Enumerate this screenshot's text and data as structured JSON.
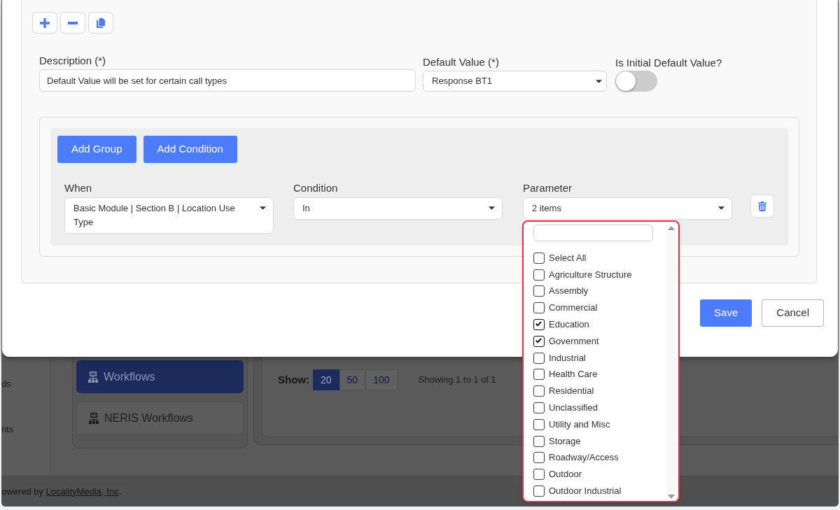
{
  "form": {
    "description": {
      "label": "Description (*)",
      "value": "Default Value will be set for certain call types"
    },
    "default_value": {
      "label": "Default Value (*)",
      "value": "Response BT1"
    },
    "is_initial_default": {
      "label": "Is Initial Default Value?",
      "on": false
    }
  },
  "query_builder": {
    "buttons": [
      "Add Group",
      "Add Condition"
    ],
    "rule": {
      "fields": [
        {
          "label": "When",
          "value": "Basic Module | Section B | Location Use Type"
        },
        {
          "label": "Condition",
          "value": "In"
        },
        {
          "label": "Parameter",
          "value": "2 items",
          "expanded": true,
          "dropdown": {
            "items": [
              {
                "label": "Select All",
                "checked": false
              },
              {
                "label": "Agriculture Structure",
                "checked": false
              },
              {
                "label": "Assembly",
                "checked": false
              },
              {
                "label": "Commercial",
                "checked": false
              },
              {
                "label": "Education",
                "checked": true
              },
              {
                "label": "Government",
                "checked": true
              },
              {
                "label": "Industrial",
                "checked": false
              },
              {
                "label": "Health Care",
                "checked": false
              },
              {
                "label": "Residential",
                "checked": false
              },
              {
                "label": "Unclassified",
                "checked": false
              },
              {
                "label": "Utility and Misc",
                "checked": false
              },
              {
                "label": "Storage",
                "checked": false
              },
              {
                "label": "Roadway/Access",
                "checked": false
              },
              {
                "label": "Outdoor",
                "checked": false
              },
              {
                "label": "Outdoor Industrial",
                "checked": false
              }
            ]
          }
        }
      ]
    }
  },
  "actions": [
    {
      "label": "Save",
      "kind": "primary"
    },
    {
      "label": "Cancel",
      "kind": "secondary"
    }
  ],
  "background_page": {
    "sidebar_items": [
      "ds",
      "nts"
    ],
    "menu_items": [
      {
        "label": "Workflows",
        "selected": true
      },
      {
        "label": "NERIS Workflows",
        "selected": false
      }
    ],
    "pagination": {
      "label": "Show:",
      "page_sizes": [
        {
          "label": "20",
          "selected": true
        },
        {
          "label": "50",
          "selected": false
        },
        {
          "label": "100",
          "selected": false
        }
      ],
      "summary": "Showing 1 to 1 of 1"
    },
    "footer": {
      "prefix": "owered by",
      "link": "LocalityMedia, Inc",
      "suffix": "."
    }
  }
}
